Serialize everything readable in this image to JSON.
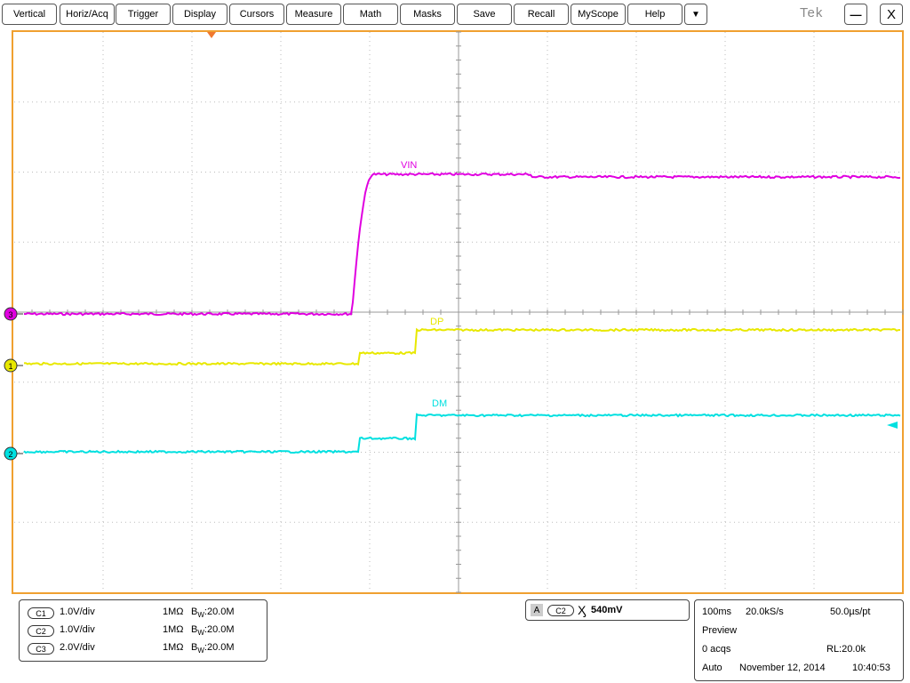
{
  "menu": {
    "items": [
      "Vertical",
      "Horiz/Acq",
      "Trigger",
      "Display",
      "Cursors",
      "Measure",
      "Math",
      "Masks",
      "Save",
      "Recall",
      "MyScope",
      "Help"
    ],
    "dropdown_glyph": "▼",
    "brand": "Tek",
    "minimize_glyph": "—",
    "close_glyph": "X"
  },
  "colors": {
    "graticule_border": "#f0a030",
    "ch1": "#e8e800",
    "ch2": "#00e0e0",
    "ch3": "#e000e0",
    "trigger_marker": "#f07830"
  },
  "waveforms": {
    "ch3": {
      "label": "VIN",
      "marker": "3"
    },
    "ch1": {
      "label": "DP",
      "marker": "1"
    },
    "ch2": {
      "label": "DM",
      "marker": "2"
    }
  },
  "channels": [
    {
      "tag": "C1",
      "scale": "1.0V/div",
      "impedance": "1MΩ",
      "bw_prefix": "B",
      "bw_sub": "W",
      "bw_value": ":20.0M"
    },
    {
      "tag": "C2",
      "scale": "1.0V/div",
      "impedance": "1MΩ",
      "bw_prefix": "B",
      "bw_sub": "W",
      "bw_value": ":20.0M"
    },
    {
      "tag": "C3",
      "scale": "2.0V/div",
      "impedance": "1MΩ",
      "bw_prefix": "B",
      "bw_sub": "W",
      "bw_value": ":20.0M"
    }
  ],
  "trigger": {
    "mode": "A",
    "source": "C2",
    "slope_glyph": "Ӽ",
    "level": "540mV"
  },
  "acquisition": {
    "timebase": "100ms",
    "sample_rate": "20.0kS/s",
    "resolution": "50.0µs/pt",
    "state": "Preview",
    "acqs": "0 acqs",
    "record_length": "RL:20.0k",
    "run_mode": "Auto",
    "date": "November 12, 2014",
    "time": "10:40:53"
  }
}
